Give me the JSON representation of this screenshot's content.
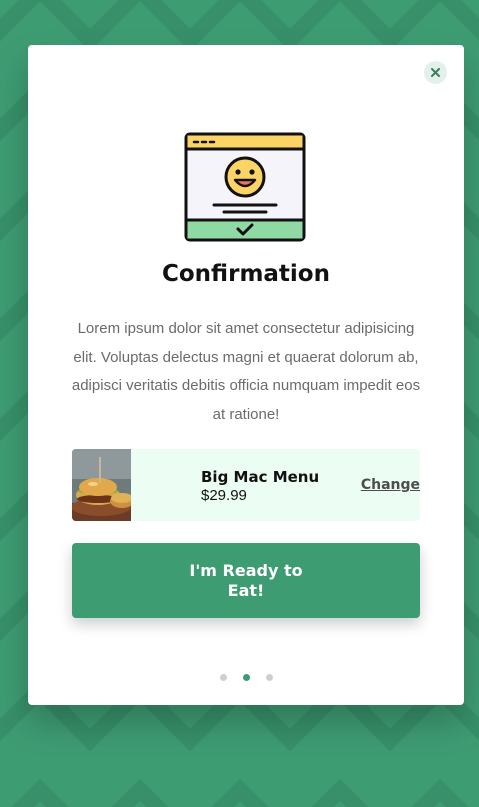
{
  "modal": {
    "title": "Confirmation",
    "description": "Lorem ipsum dolor sit amet consectetur adipisicing elit. Voluptas delectus magni et quaerat dolorum ab, adipisci veritatis debitis officia numquam impedit eos at ratione!",
    "close_icon": "close-icon",
    "illustration": "smiley-confirmation-window-icon"
  },
  "order": {
    "image": "burger-photo",
    "name": "Big Mac Menu",
    "price": "$29.99",
    "change_label": "Change"
  },
  "cta": {
    "label": "I'm Ready to Eat!"
  },
  "pagination": {
    "total": 3,
    "active": 2
  },
  "colors": {
    "brand": "#3e9c73",
    "order_card_bg": "#ecfdf3",
    "close_bg": "#e3f1ea",
    "text_dark": "#111111",
    "text_muted": "#6b6b6b"
  }
}
